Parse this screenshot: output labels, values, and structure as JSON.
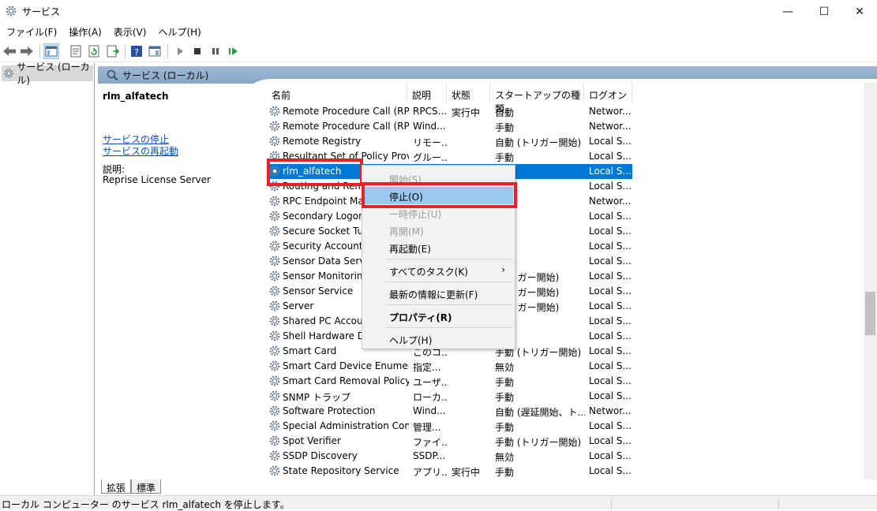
{
  "window": {
    "title": "サービス",
    "min_glyph": "—",
    "max_glyph": "☐",
    "close_glyph": "✕"
  },
  "menu": [
    "ファイル(F)",
    "操作(A)",
    "表示(V)",
    "ヘルプ(H)"
  ],
  "tree": {
    "root_label": "サービス (ローカル)"
  },
  "content_header": {
    "title": "サービス (ローカル)"
  },
  "detail": {
    "service_name": "rlm_alfatech",
    "stop_link": "サービスの停止",
    "restart_link": "サービスの再起動",
    "description_label": "説明:",
    "description_text": "Reprise License Server"
  },
  "columns": [
    "名前",
    "説明",
    "状態",
    "スタートアップの種類",
    "ログオン"
  ],
  "rows": [
    {
      "name": "Remote Procedure Call (RPC)",
      "desc": "RPCS...",
      "status": "実行中",
      "startup": "自動",
      "logon": "Networ..."
    },
    {
      "name": "Remote Procedure Call (RPC...",
      "desc": "Wind...",
      "status": "",
      "startup": "手動",
      "logon": "Networ..."
    },
    {
      "name": "Remote Registry",
      "desc": "リモー...",
      "status": "",
      "startup": "自動 (トリガー開始)",
      "logon": "Local S..."
    },
    {
      "name": "Resultant Set of Policy Provi...",
      "desc": "グルー...",
      "status": "",
      "startup": "手動",
      "logon": "Local S..."
    },
    {
      "name": "rlm_alfatech",
      "desc": "",
      "status": "",
      "startup": "",
      "logon": "Local S..."
    },
    {
      "name": "Routing and Remo",
      "desc": "",
      "status": "",
      "startup": "",
      "logon": "Local S..."
    },
    {
      "name": "RPC Endpoint Map",
      "desc": "",
      "status": "",
      "startup": "",
      "logon": "Networ..."
    },
    {
      "name": "Secondary Logon",
      "desc": "",
      "status": "",
      "startup": "",
      "logon": "Local S..."
    },
    {
      "name": "Secure Socket Tunn",
      "desc": "",
      "status": "",
      "startup": "",
      "logon": "Local S..."
    },
    {
      "name": "Security Accounts",
      "desc": "",
      "status": "",
      "startup": "",
      "logon": "Local S..."
    },
    {
      "name": "Sensor Data Service",
      "desc": "",
      "status": "",
      "startup": "",
      "logon": "Local S..."
    },
    {
      "name": "Sensor Monitoring",
      "desc": "",
      "status": "",
      "startup": "(トリガー開始)",
      "logon": "Local S..."
    },
    {
      "name": "Sensor Service",
      "desc": "",
      "status": "",
      "startup": "(トリガー開始)",
      "logon": "Local S..."
    },
    {
      "name": "Server",
      "desc": "",
      "status": "",
      "startup": "(トリガー開始)",
      "logon": "Local S..."
    },
    {
      "name": "Shared PC Account",
      "desc": "",
      "status": "",
      "startup": "",
      "logon": "Local S..."
    },
    {
      "name": "Shell Hardware Det",
      "desc": "",
      "status": "",
      "startup": "",
      "logon": "Local S..."
    },
    {
      "name": "Smart Card",
      "desc": "このコ...",
      "status": "",
      "startup": "手動 (トリガー開始)",
      "logon": "Local S..."
    },
    {
      "name": "Smart Card Device Enumera...",
      "desc": "指定...",
      "status": "",
      "startup": "無効",
      "logon": "Local S..."
    },
    {
      "name": "Smart Card Removal Policy",
      "desc": "ユーザ...",
      "status": "",
      "startup": "手動",
      "logon": "Local S..."
    },
    {
      "name": "SNMP トラップ",
      "desc": "ローカ...",
      "status": "",
      "startup": "手動",
      "logon": "Local S..."
    },
    {
      "name": "Software Protection",
      "desc": "Wind...",
      "status": "",
      "startup": "自動 (遅延開始、ト...",
      "logon": "Networ..."
    },
    {
      "name": "Special Administration Cons...",
      "desc": "管理...",
      "status": "",
      "startup": "手動",
      "logon": "Local S..."
    },
    {
      "name": "Spot Verifier",
      "desc": "ファイ...",
      "status": "",
      "startup": "手動 (トリガー開始)",
      "logon": "Local S..."
    },
    {
      "name": "SSDP Discovery",
      "desc": "SSDP...",
      "status": "",
      "startup": "無効",
      "logon": "Local S..."
    },
    {
      "name": "State Repository Service",
      "desc": "アプリ...",
      "status": "実行中",
      "startup": "手動",
      "logon": "Local S..."
    }
  ],
  "context_menu": {
    "start": "開始(S)",
    "stop": "停止(O)",
    "pause": "一時停止(U)",
    "resume": "再開(M)",
    "restart": "再起動(E)",
    "all_tasks": "すべてのタスク(K)",
    "submenu_arrow": "›",
    "refresh": "最新の情報に更新(F)",
    "properties": "プロパティ(R)",
    "help": "ヘルプ(H)"
  },
  "tabs": [
    "拡張",
    "標準"
  ],
  "status_text": "ローカル コンピューター のサービス rlm_alfatech を停止します。",
  "colors": {
    "selection": "#0078d7",
    "highlight_box": "#e8202a",
    "menu_hover": "#9bc7ee",
    "header_band": "#93afce"
  }
}
